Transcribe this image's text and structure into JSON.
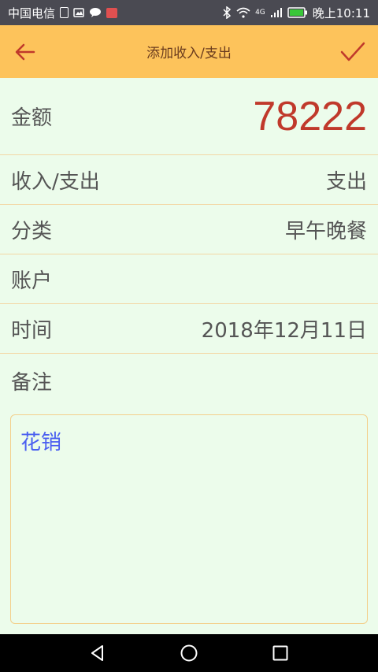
{
  "status_bar": {
    "carrier": "中国电信",
    "network": "4G",
    "time": "晚上10:11"
  },
  "toolbar": {
    "title": "添加收入/支出"
  },
  "form": {
    "amount": {
      "label": "金额",
      "value": "78222"
    },
    "type": {
      "label": "收入/支出",
      "value": "支出"
    },
    "category": {
      "label": "分类",
      "value": "早午晚餐"
    },
    "account": {
      "label": "账户",
      "value": ""
    },
    "date": {
      "label": "时间",
      "value": "2018年12月11日"
    },
    "note": {
      "label": "备注",
      "value": "花销"
    }
  },
  "colors": {
    "toolbar_bg": "#fdc35b",
    "page_bg": "#ecfceb",
    "amount": "#c0392b",
    "note_text": "#4a5ff0",
    "divider": "#f3d7a5"
  }
}
